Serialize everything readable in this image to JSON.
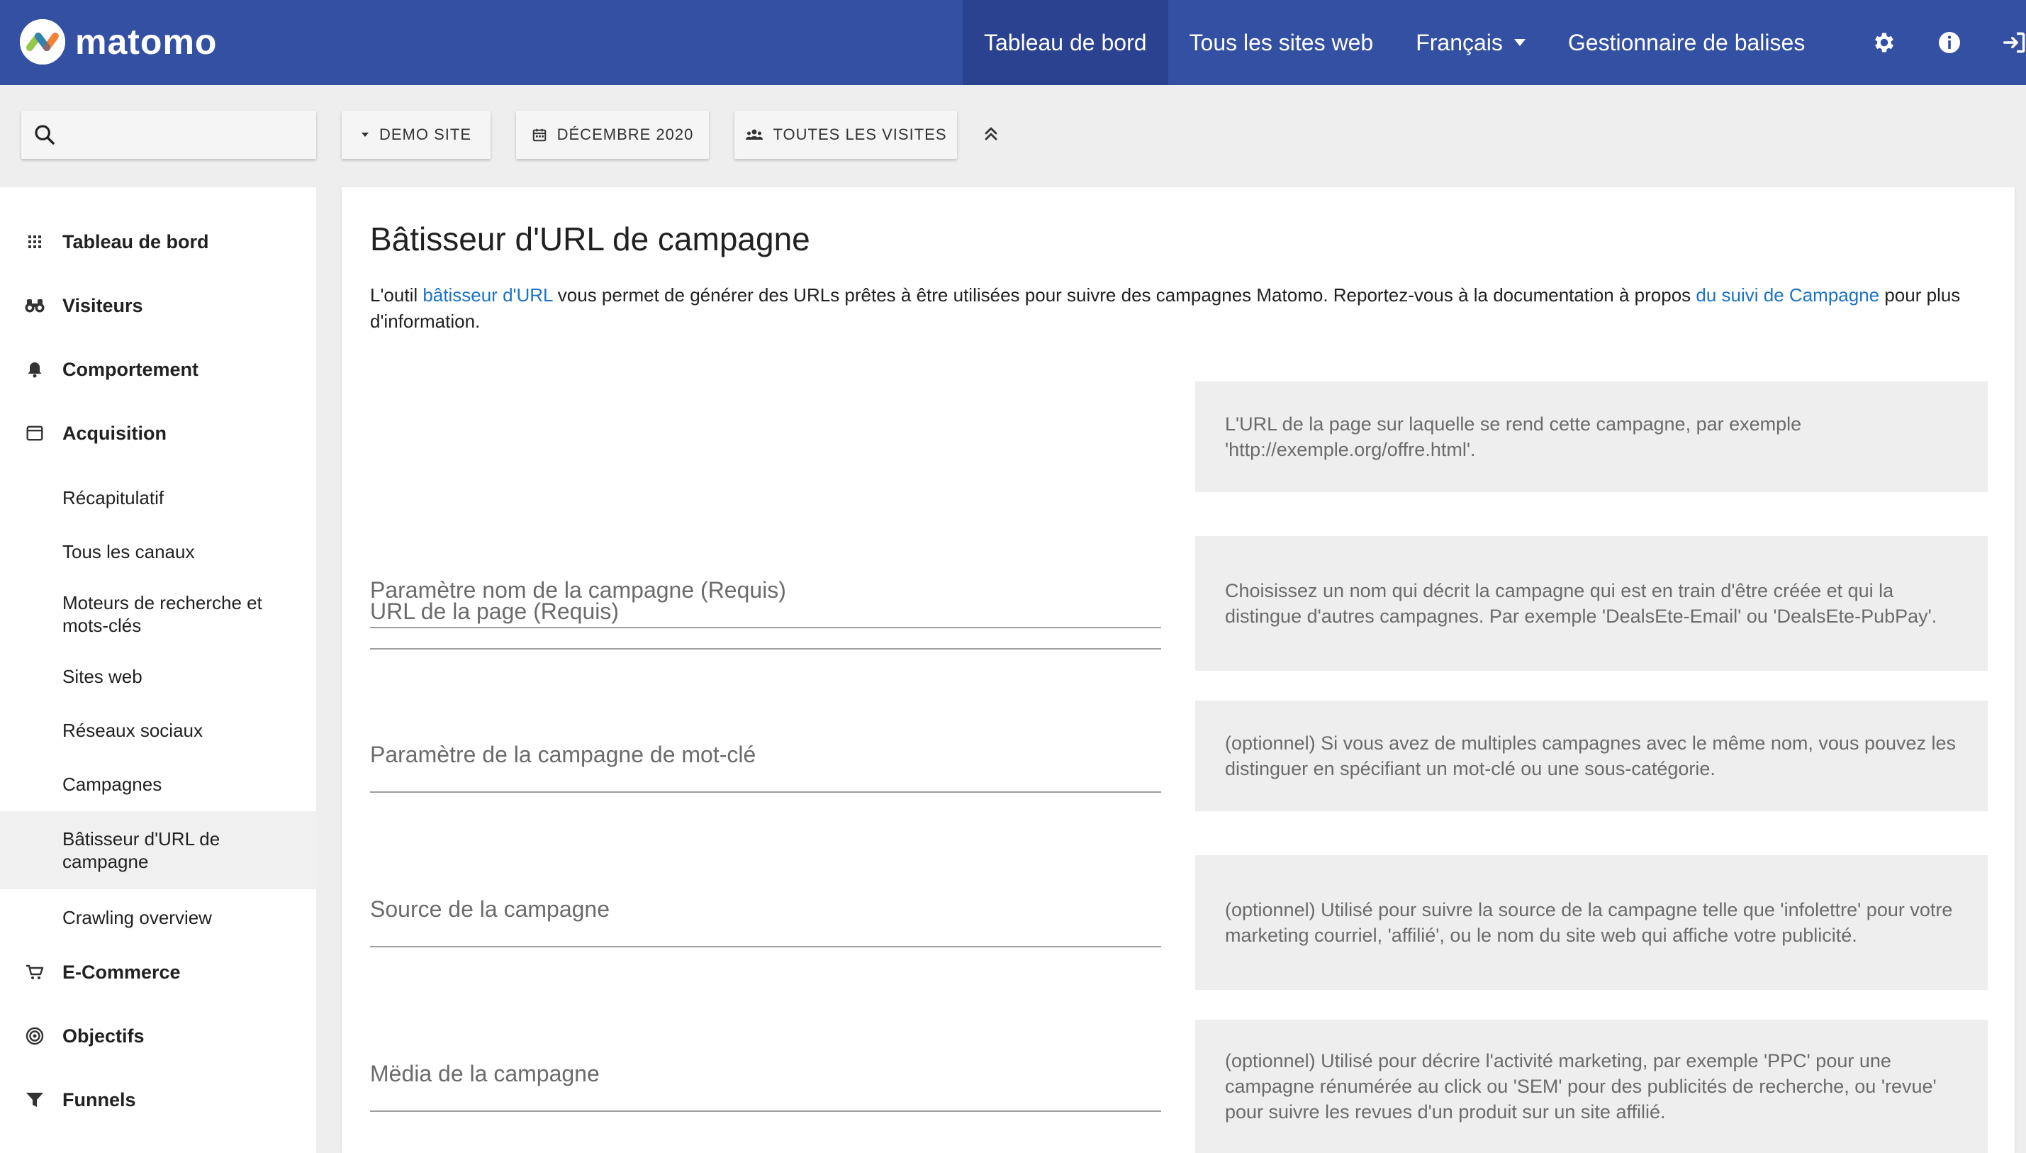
{
  "app": {
    "logo_text": "matomo"
  },
  "topnav": {
    "items": [
      {
        "label": "Tableau de bord"
      },
      {
        "label": "Tous les sites web"
      },
      {
        "label": "Français"
      },
      {
        "label": "Gestionnaire de balises"
      }
    ]
  },
  "toolbar": {
    "search_placeholder": "",
    "site": "DEMO SITE",
    "date": "DÉCEMBRE 2020",
    "segment": "TOUTES LES VISITES"
  },
  "sidebar": {
    "categories": [
      {
        "label": "Tableau de bord",
        "icon": "dashboard-icon"
      },
      {
        "label": "Visiteurs",
        "icon": "binoculars-icon"
      },
      {
        "label": "Comportement",
        "icon": "bell-icon"
      },
      {
        "label": "Acquisition",
        "icon": "calendar-icon"
      },
      {
        "label": "E-Commerce",
        "icon": "cart-icon"
      },
      {
        "label": "Objectifs",
        "icon": "target-icon"
      },
      {
        "label": "Funnels",
        "icon": "funnel-icon"
      }
    ],
    "acquisition_items": [
      {
        "label": "Récapitulatif"
      },
      {
        "label": "Tous les canaux"
      },
      {
        "label": "Moteurs de recherche et mots-clés"
      },
      {
        "label": "Sites web"
      },
      {
        "label": "Réseaux sociaux"
      },
      {
        "label": "Campagnes"
      },
      {
        "label": "Bâtisseur d'URL de campagne"
      },
      {
        "label": "Crawling overview"
      }
    ]
  },
  "main": {
    "title": "Bâtisseur d'URL de campagne",
    "intro": {
      "part1": "L'outil ",
      "link1": "bâtisseur d'URL",
      "part2": " vous permet de générer des URLs prêtes à être utilisées pour suivre des campagnes Matomo. Reportez-vous à la documentation à propos ",
      "link2": "du suivi de Campagne",
      "part3": " pour plus d'information."
    },
    "fields": [
      {
        "label": "URL de la page (Requis)",
        "value": "",
        "help": "L'URL de la page sur laquelle se rend cette campagne, par exemple 'http://exemple.org/offre.html'."
      },
      {
        "label": "Paramètre nom de la campagne (Requis)",
        "value": "",
        "help": "Choisissez un nom qui décrit la campagne qui est en train d'être créée et qui la distingue d'autres campagnes. Par exemple 'DealsEte-Email' ou 'DealsEte-PubPay'."
      },
      {
        "label": "Paramètre de la campagne de mot-clé",
        "value": "",
        "help": "(optionnel) Si vous avez de multiples campagnes avec le même nom, vous pouvez les distinguer en spécifiant un mot-clé ou une sous-catégorie."
      },
      {
        "label": "Source de la campagne",
        "value": "",
        "help": "(optionnel) Utilisé pour suivre la source de la campagne telle que 'infolettre' pour votre marketing courriel, 'affilié', ou le nom du site web qui affiche votre publicité."
      },
      {
        "label": "Mëdia de la campagne",
        "value": "",
        "help": "(optionnel) Utilisé pour décrire l'activité marketing, par exemple 'PPC' pour une campagne rénumérée au click ou 'SEM' pour des publicités de recherche, ou 'revue' pour suivre les revues d'un produit sur un site affilié."
      }
    ]
  },
  "colors": {
    "topbar": "#3450a3",
    "topbar_active": "#2a4290",
    "link": "#1a73c7",
    "help_bg": "#eeeeee"
  }
}
